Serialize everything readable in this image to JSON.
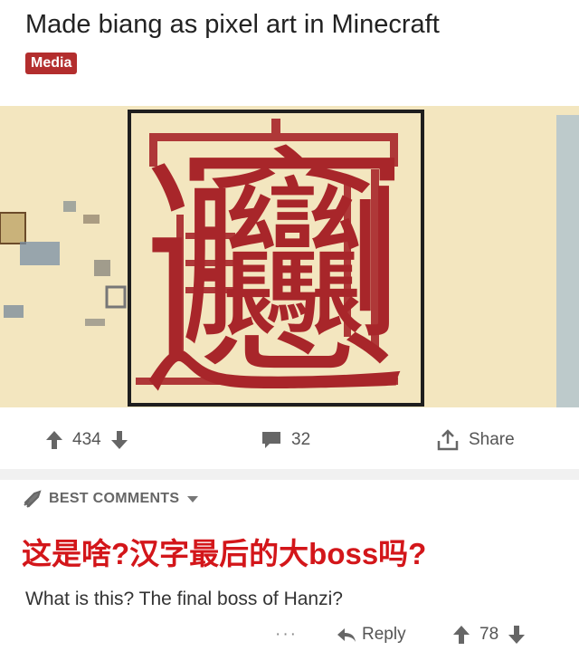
{
  "post": {
    "title": "Made biang as pixel art in Minecraft",
    "tag": "Media"
  },
  "media": {
    "character": "𰻞"
  },
  "actions": {
    "upvotes": "434",
    "comments": "32",
    "share_label": "Share"
  },
  "comments_header": {
    "label": "BEST COMMENTS"
  },
  "caption": {
    "text": "这是啥?汉字最后的大boss吗?"
  },
  "comment": {
    "text": "What is this? The final boss of Hanzi?",
    "more": "···",
    "reply_label": "Reply",
    "votes": "78"
  },
  "colors": {
    "tag_bg": "#b32e2e",
    "caption": "#d3161a",
    "glyph": "#a8262a",
    "media_bg": "#f3e6bf"
  }
}
